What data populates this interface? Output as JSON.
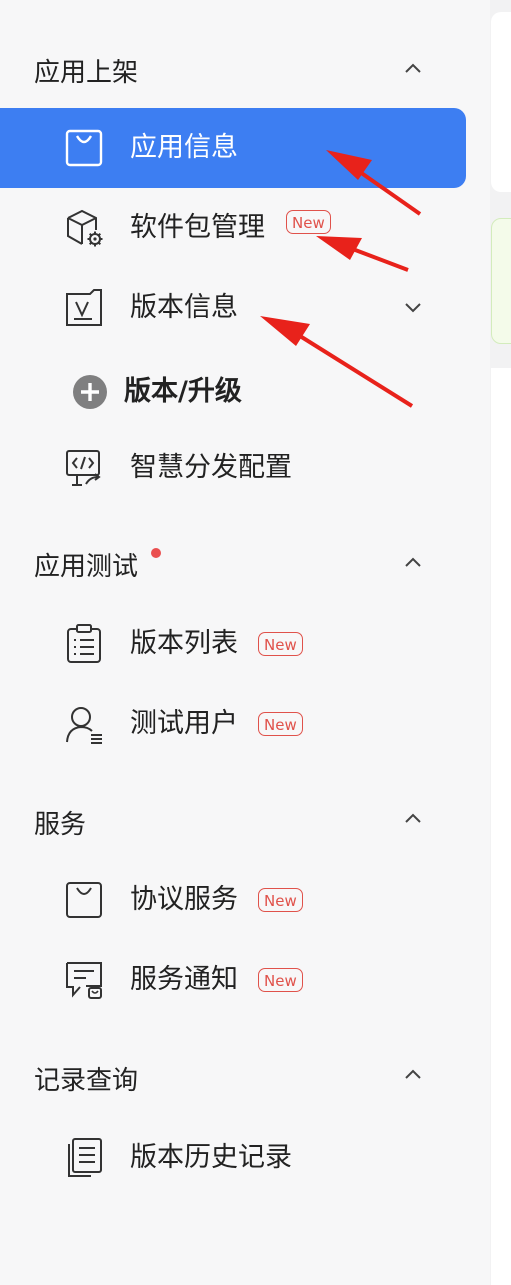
{
  "sections": {
    "publish": {
      "title": "应用上架",
      "items": {
        "app_info": "应用信息",
        "package_mgmt": "软件包管理",
        "version_info": "版本信息",
        "version_upgrade": "版本/升级",
        "smart_distribution": "智慧分发配置"
      }
    },
    "testing": {
      "title": "应用测试",
      "items": {
        "version_list": "版本列表",
        "test_users": "测试用户"
      }
    },
    "services": {
      "title": "服务",
      "items": {
        "agreement_service": "协议服务",
        "service_notice": "服务通知"
      }
    },
    "records": {
      "title": "记录查询",
      "items": {
        "version_history": "版本历史记录"
      }
    }
  },
  "badge_new": "New",
  "colors": {
    "active_bg": "#3d7ef2",
    "badge": "#e0524b",
    "dot": "#ea4f4f",
    "arrow": "#e8221b"
  }
}
